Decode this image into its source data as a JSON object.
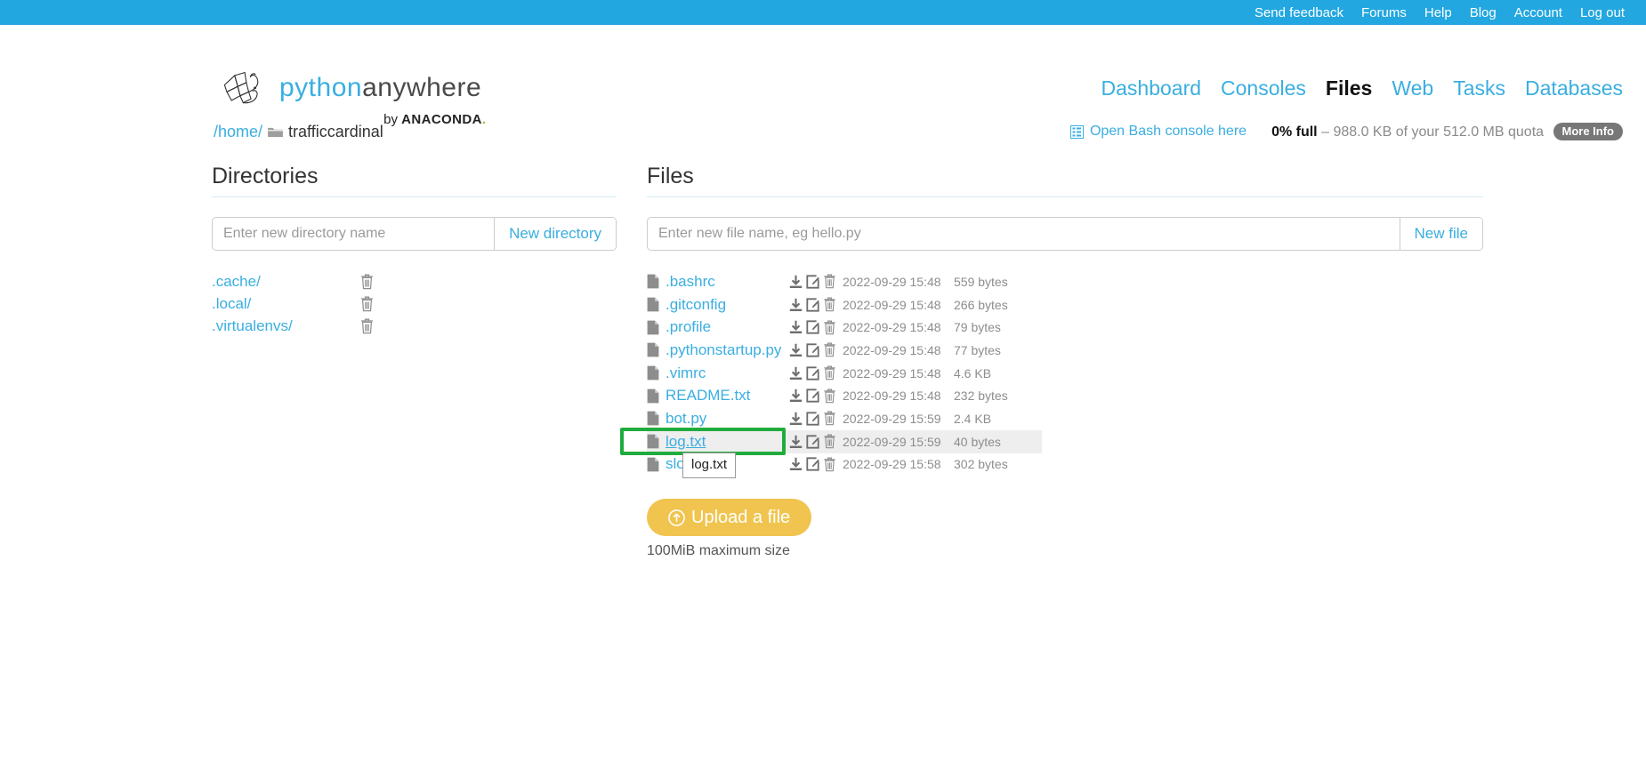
{
  "topbar": {
    "links": [
      {
        "label": "Send feedback",
        "name": "send-feedback"
      },
      {
        "label": "Forums",
        "name": "forums"
      },
      {
        "label": "Help",
        "name": "help"
      },
      {
        "label": "Blog",
        "name": "blog"
      },
      {
        "label": "Account",
        "name": "account"
      },
      {
        "label": "Log out",
        "name": "log-out"
      }
    ],
    "bg_color": "#22a7e0"
  },
  "brand": {
    "word_python": "python",
    "word_anywhere": "anywhere",
    "by": "by",
    "anaconda": "ANACONDA",
    "anaconda_dot": ".",
    "logo_icon": "python-snake-logo"
  },
  "mainnav": {
    "items": [
      {
        "label": "Dashboard",
        "active": false
      },
      {
        "label": "Consoles",
        "active": false
      },
      {
        "label": "Files",
        "active": true
      },
      {
        "label": "Web",
        "active": false
      },
      {
        "label": "Tasks",
        "active": false
      },
      {
        "label": "Databases",
        "active": false
      }
    ],
    "link_color": "#3aaee0",
    "active_color": "#111111"
  },
  "breadcrumb": {
    "home": "/home/",
    "folder_icon": "folder-icon",
    "current": "trafficcardinal"
  },
  "quota": {
    "console_icon": "console-icon",
    "console_link": "Open Bash console here",
    "percent_full": "0% full",
    "dash": "–",
    "usage": "988.0 KB of your 512.0 MB quota",
    "more_info": "More Info"
  },
  "directories": {
    "title": "Directories",
    "input_placeholder": "Enter new directory name",
    "input_value": "",
    "new_button": "New directory",
    "items": [
      {
        "name": ".cache/",
        "delete_icon": "trash-icon"
      },
      {
        "name": ".local/",
        "delete_icon": "trash-icon"
      },
      {
        "name": ".virtualenvs/",
        "delete_icon": "trash-icon"
      }
    ]
  },
  "files": {
    "title": "Files",
    "input_placeholder": "Enter new file name, eg hello.py",
    "input_value": "",
    "new_button": "New file",
    "row_icons": {
      "file": "file-icon",
      "download": "download-icon",
      "edit": "edit-icon",
      "delete": "trash-icon"
    },
    "items": [
      {
        "name": ".bashrc",
        "date": "2022-09-29 15:48",
        "size": "559 bytes",
        "hovered": false
      },
      {
        "name": ".gitconfig",
        "date": "2022-09-29 15:48",
        "size": "266 bytes",
        "hovered": false
      },
      {
        "name": ".profile",
        "date": "2022-09-29 15:48",
        "size": "79 bytes",
        "hovered": false
      },
      {
        "name": ".pythonstartup.py",
        "date": "2022-09-29 15:48",
        "size": "77 bytes",
        "hovered": false
      },
      {
        "name": ".vimrc",
        "date": "2022-09-29 15:48",
        "size": "4.6 KB",
        "hovered": false
      },
      {
        "name": "README.txt",
        "date": "2022-09-29 15:48",
        "size": "232 bytes",
        "hovered": false
      },
      {
        "name": "bot.py",
        "date": "2022-09-29 15:59",
        "size": "2.4 KB",
        "hovered": false
      },
      {
        "name": "log.txt",
        "date": "2022-09-29 15:59",
        "size": "40 bytes",
        "hovered": true
      },
      {
        "name": "slow.py",
        "date": "2022-09-29 15:58",
        "size": "302 bytes",
        "hovered": false
      }
    ],
    "upload_button": "Upload a file",
    "upload_icon": "upload-circle-icon",
    "upload_note": "100MiB maximum size"
  },
  "tooltip": {
    "text": "log.txt"
  },
  "highlight": {
    "color": "#20ac3d",
    "target": "log.txt"
  }
}
